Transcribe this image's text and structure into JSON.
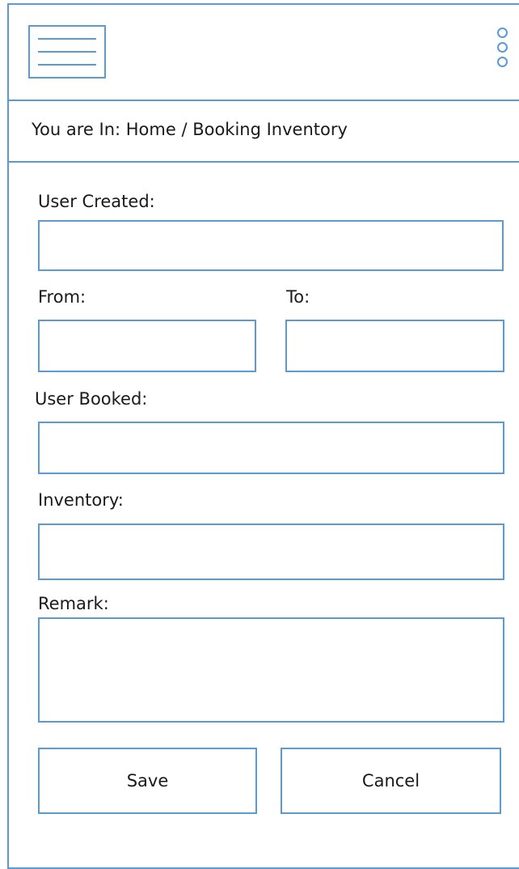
{
  "breadcrumb": {
    "text": "You are In: Home / Booking Inventory"
  },
  "form": {
    "user_created": {
      "label": "User Created:",
      "value": "",
      "placeholder": ""
    },
    "from": {
      "label": "From:",
      "value": "",
      "placeholder": ""
    },
    "to": {
      "label": "To:",
      "value": "",
      "placeholder": ""
    },
    "user_booked": {
      "label": "User Booked:",
      "value": "",
      "placeholder": ""
    },
    "inventory": {
      "label": "Inventory:",
      "value": "",
      "placeholder": ""
    },
    "remark": {
      "label": "Remark:",
      "value": "",
      "placeholder": ""
    }
  },
  "buttons": {
    "save": "Save",
    "cancel": "Cancel"
  },
  "icons": {
    "menu": "hamburger-menu-icon",
    "more": "vertical-dots-icon"
  },
  "colors": {
    "accent": "#5b9bd5"
  }
}
